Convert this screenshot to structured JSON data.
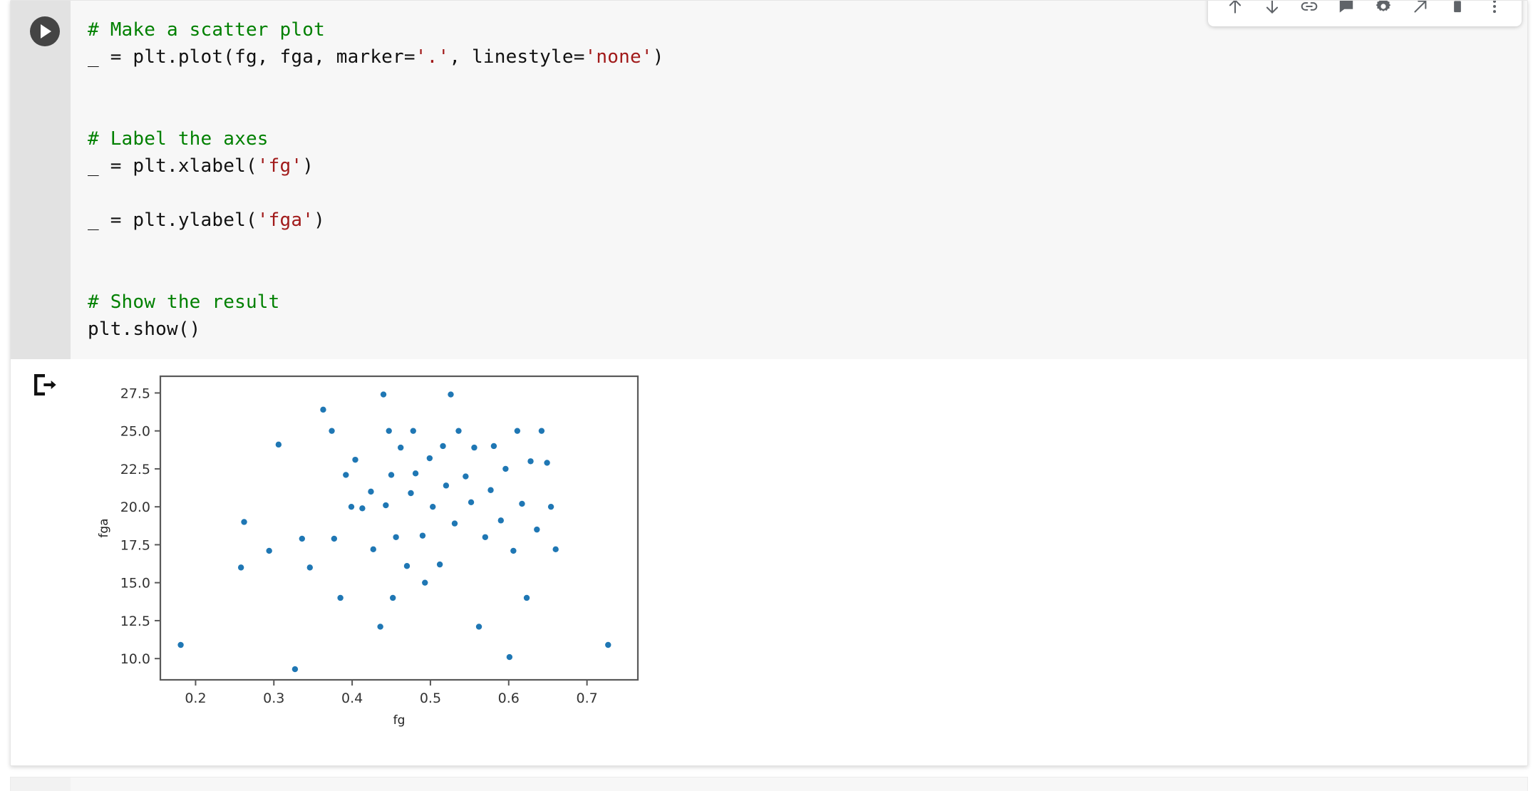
{
  "cell": {
    "run_button_label": "Run cell",
    "output_icon_name": "output-arrow-icon"
  },
  "toolbar": {
    "buttons": [
      {
        "name": "move-cell-up",
        "icon": "arrow-up-icon",
        "label": "Move cell up"
      },
      {
        "name": "move-cell-down",
        "icon": "arrow-down-icon",
        "label": "Move cell down"
      },
      {
        "name": "link-to-cell",
        "icon": "link-icon",
        "label": "Link to cell"
      },
      {
        "name": "add-comment",
        "icon": "comment-icon",
        "label": "Add a comment"
      },
      {
        "name": "cell-settings",
        "icon": "gear-icon",
        "label": "Cell settings"
      },
      {
        "name": "open-in-new-tab",
        "icon": "external-link-icon",
        "label": "Open in new tab"
      },
      {
        "name": "delete-cell",
        "icon": "trash-icon",
        "label": "Delete cell"
      },
      {
        "name": "more-options",
        "icon": "vertical-dots-icon",
        "label": "More cell actions"
      }
    ]
  },
  "code": {
    "lines": [
      {
        "segments": [
          {
            "t": "# Make a scatter plot",
            "c": "cmt"
          }
        ]
      },
      {
        "segments": [
          {
            "t": "_ = plt.plot(fg, fga, marker=",
            "c": "plain"
          },
          {
            "t": "'.'",
            "c": "str"
          },
          {
            "t": ", linestyle=",
            "c": "plain"
          },
          {
            "t": "'none'",
            "c": "str"
          },
          {
            "t": ")",
            "c": "plain"
          }
        ]
      },
      {
        "segments": [
          {
            "t": "",
            "c": "plain"
          }
        ]
      },
      {
        "segments": [
          {
            "t": "",
            "c": "plain"
          }
        ]
      },
      {
        "segments": [
          {
            "t": "# Label the axes",
            "c": "cmt"
          }
        ]
      },
      {
        "segments": [
          {
            "t": "_ = plt.xlabel(",
            "c": "plain"
          },
          {
            "t": "'fg'",
            "c": "str"
          },
          {
            "t": ")",
            "c": "plain"
          }
        ]
      },
      {
        "segments": [
          {
            "t": "",
            "c": "plain"
          }
        ]
      },
      {
        "segments": [
          {
            "t": "_ = plt.ylabel(",
            "c": "plain"
          },
          {
            "t": "'fga'",
            "c": "str"
          },
          {
            "t": ")",
            "c": "plain"
          }
        ]
      },
      {
        "segments": [
          {
            "t": "",
            "c": "plain"
          }
        ]
      },
      {
        "segments": [
          {
            "t": "",
            "c": "plain"
          }
        ]
      },
      {
        "segments": [
          {
            "t": "# Show the result",
            "c": "cmt"
          }
        ]
      },
      {
        "segments": [
          {
            "t": "plt.show()",
            "c": "plain"
          }
        ]
      }
    ]
  },
  "chart_data": {
    "type": "scatter",
    "title": "",
    "xlabel": "fg",
    "ylabel": "fga",
    "marker": ".",
    "linestyle": "none",
    "color": "#1f77b4",
    "grid": false,
    "legend": false,
    "xlim": [
      0.155,
      0.765
    ],
    "ylim": [
      8.6,
      28.6
    ],
    "xticks": [
      0.2,
      0.3,
      0.4,
      0.5,
      0.6,
      0.7
    ],
    "yticks": [
      10.0,
      12.5,
      15.0,
      17.5,
      20.0,
      22.5,
      25.0,
      27.5
    ],
    "xtick_labels": [
      "0.2",
      "0.3",
      "0.4",
      "0.5",
      "0.6",
      "0.7"
    ],
    "ytick_labels": [
      "10.0",
      "12.5",
      "15.0",
      "17.5",
      "20.0",
      "22.5",
      "25.0",
      "27.5"
    ],
    "points": [
      {
        "x": 0.181,
        "y": 10.9
      },
      {
        "x": 0.258,
        "y": 16.0
      },
      {
        "x": 0.262,
        "y": 19.0
      },
      {
        "x": 0.294,
        "y": 17.1
      },
      {
        "x": 0.306,
        "y": 24.1
      },
      {
        "x": 0.327,
        "y": 9.3
      },
      {
        "x": 0.336,
        "y": 17.9
      },
      {
        "x": 0.346,
        "y": 16.0
      },
      {
        "x": 0.363,
        "y": 26.4
      },
      {
        "x": 0.374,
        "y": 25.0
      },
      {
        "x": 0.377,
        "y": 17.9
      },
      {
        "x": 0.385,
        "y": 14.0
      },
      {
        "x": 0.392,
        "y": 22.1
      },
      {
        "x": 0.399,
        "y": 20.0
      },
      {
        "x": 0.404,
        "y": 23.1
      },
      {
        "x": 0.413,
        "y": 19.9
      },
      {
        "x": 0.424,
        "y": 21.0
      },
      {
        "x": 0.427,
        "y": 17.2
      },
      {
        "x": 0.436,
        "y": 12.1
      },
      {
        "x": 0.44,
        "y": 27.4
      },
      {
        "x": 0.443,
        "y": 20.1
      },
      {
        "x": 0.447,
        "y": 25.0
      },
      {
        "x": 0.45,
        "y": 22.1
      },
      {
        "x": 0.452,
        "y": 14.0
      },
      {
        "x": 0.456,
        "y": 18.0
      },
      {
        "x": 0.462,
        "y": 23.9
      },
      {
        "x": 0.47,
        "y": 16.1
      },
      {
        "x": 0.475,
        "y": 20.9
      },
      {
        "x": 0.478,
        "y": 25.0
      },
      {
        "x": 0.481,
        "y": 22.2
      },
      {
        "x": 0.49,
        "y": 18.1
      },
      {
        "x": 0.493,
        "y": 15.0
      },
      {
        "x": 0.499,
        "y": 23.2
      },
      {
        "x": 0.503,
        "y": 20.0
      },
      {
        "x": 0.512,
        "y": 16.2
      },
      {
        "x": 0.516,
        "y": 24.0
      },
      {
        "x": 0.52,
        "y": 21.4
      },
      {
        "x": 0.526,
        "y": 27.4
      },
      {
        "x": 0.531,
        "y": 18.9
      },
      {
        "x": 0.536,
        "y": 25.0
      },
      {
        "x": 0.545,
        "y": 22.0
      },
      {
        "x": 0.552,
        "y": 20.3
      },
      {
        "x": 0.556,
        "y": 23.9
      },
      {
        "x": 0.562,
        "y": 12.1
      },
      {
        "x": 0.57,
        "y": 18.0
      },
      {
        "x": 0.577,
        "y": 21.1
      },
      {
        "x": 0.581,
        "y": 24.0
      },
      {
        "x": 0.59,
        "y": 19.1
      },
      {
        "x": 0.596,
        "y": 22.5
      },
      {
        "x": 0.601,
        "y": 10.1
      },
      {
        "x": 0.606,
        "y": 17.1
      },
      {
        "x": 0.611,
        "y": 25.0
      },
      {
        "x": 0.617,
        "y": 20.2
      },
      {
        "x": 0.623,
        "y": 14.0
      },
      {
        "x": 0.628,
        "y": 23.0
      },
      {
        "x": 0.636,
        "y": 18.5
      },
      {
        "x": 0.642,
        "y": 25.0
      },
      {
        "x": 0.649,
        "y": 22.9
      },
      {
        "x": 0.654,
        "y": 20.0
      },
      {
        "x": 0.66,
        "y": 17.2
      },
      {
        "x": 0.727,
        "y": 10.9
      }
    ]
  }
}
